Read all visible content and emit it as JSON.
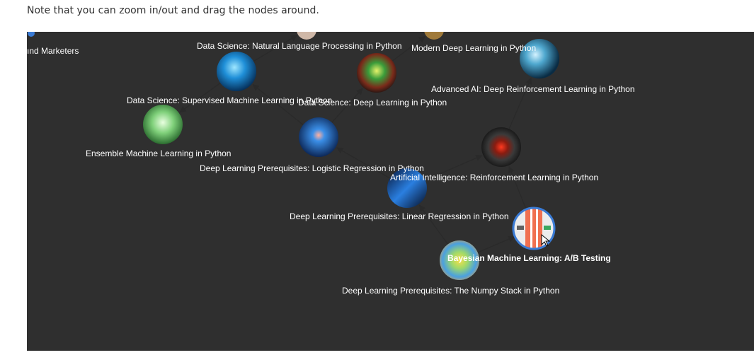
{
  "note": "Note that you can zoom in/out and drag the nodes around.",
  "colors": {
    "canvas_bg": "#2f2f2f",
    "label": "#ffffff",
    "edge": "#2a2a2a",
    "selected_ring": "#3a7bd5"
  },
  "nodes": [
    {
      "id": "marketers",
      "label": "ınd Marketers",
      "icon": "blue-icon",
      "bold": false
    },
    {
      "id": "nlp",
      "label": "Data Science: Natural Language Processing in Python",
      "icon": "hidden-node-icon",
      "bold": false
    },
    {
      "id": "mdl",
      "label": "Modern Deep Learning in Python",
      "icon": "hidden-node-icon",
      "bold": false
    },
    {
      "id": "sml",
      "label": "Data Science: Supervised Machine Learning in Python",
      "icon": "blue-brain-icon",
      "bold": false
    },
    {
      "id": "dl",
      "label": "Data Science: Deep Learning in Python",
      "icon": "neurons-icon",
      "bold": false
    },
    {
      "id": "adv",
      "label": "Advanced AI: Deep Reinforcement Learning in Python",
      "icon": "robot-face-icon",
      "bold": false
    },
    {
      "id": "ens",
      "label": "Ensemble Machine Learning in Python",
      "icon": "green-brain-icon",
      "bold": false
    },
    {
      "id": "logreg",
      "label": "Deep Learning Prerequisites: Logistic Regression in Python",
      "icon": "blue-neuron-icon",
      "bold": false
    },
    {
      "id": "rl",
      "label": "Artificial Intelligence: Reinforcement Learning in Python",
      "icon": "robot-eye-icon",
      "bold": false
    },
    {
      "id": "linreg",
      "label": "Deep Learning Prerequisites: Linear Regression in Python",
      "icon": "blue-wave-icon",
      "bold": false
    },
    {
      "id": "ab",
      "label": "Bayesian Machine Learning: A/B Testing",
      "icon": "ab-test-icon",
      "bold": true,
      "selected": true
    },
    {
      "id": "numpy",
      "label": "Deep Learning Prerequisites: The Numpy Stack in Python",
      "icon": "heatmap-icon",
      "bold": false
    }
  ],
  "edges": [
    {
      "from": "numpy",
      "to": "linreg"
    },
    {
      "from": "linreg",
      "to": "logreg"
    },
    {
      "from": "logreg",
      "to": "dl"
    },
    {
      "from": "logreg",
      "to": "sml"
    },
    {
      "from": "dl",
      "to": "mdl"
    },
    {
      "from": "linreg",
      "to": "rl"
    },
    {
      "from": "rl",
      "to": "adv"
    },
    {
      "from": "ab",
      "to": "rl"
    },
    {
      "from": "numpy",
      "to": "ab"
    },
    {
      "from": "sml",
      "to": "ens"
    },
    {
      "from": "sml",
      "to": "nlp"
    }
  ]
}
